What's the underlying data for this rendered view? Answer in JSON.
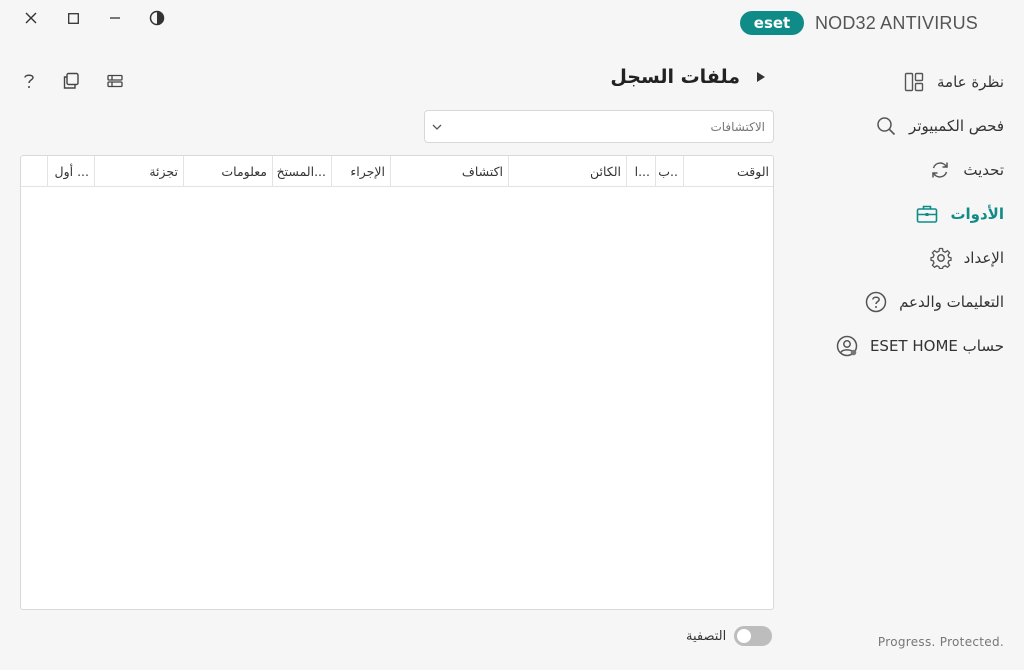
{
  "brand": {
    "product": "NOD32 ANTIVIRUS",
    "logo_text": "eset",
    "accent": "#0f8c87"
  },
  "window_controls": [
    {
      "name": "close-icon",
      "glyph": "✕"
    },
    {
      "name": "maximize-icon",
      "glyph": "☐"
    },
    {
      "name": "minimize-icon",
      "glyph": "—"
    },
    {
      "name": "contrast-icon",
      "glyph": "◐"
    }
  ],
  "sidebar": {
    "items": [
      {
        "label": "نظرة عامة",
        "icon": "dashboard-icon",
        "active": false
      },
      {
        "label": "فحص الكمبيوتر",
        "icon": "search-icon",
        "active": false
      },
      {
        "label": "تحديث",
        "icon": "refresh-icon",
        "active": false
      },
      {
        "label": "الأدوات",
        "icon": "briefcase-icon",
        "active": true
      },
      {
        "label": "الإعداد",
        "icon": "gear-icon",
        "active": false
      },
      {
        "label": "التعليمات والدعم",
        "icon": "help-icon",
        "active": false
      },
      {
        "label": "حساب ESET HOME",
        "icon": "account-icon",
        "active": false
      }
    ]
  },
  "page": {
    "title": "ملفات السجل"
  },
  "dropdown": {
    "value": "الاكتشافات"
  },
  "table": {
    "columns": [
      "الوقت",
      "ب..",
      "ا...",
      "الكائن",
      "اكتشاف",
      "الإجراء",
      "المستخ...",
      "معلومات",
      "تجزئة",
      "أول ...",
      ""
    ],
    "rows": []
  },
  "footer": {
    "filter_label": "التصفية",
    "filter_on": false,
    "tagline": "Progress. Protected."
  }
}
